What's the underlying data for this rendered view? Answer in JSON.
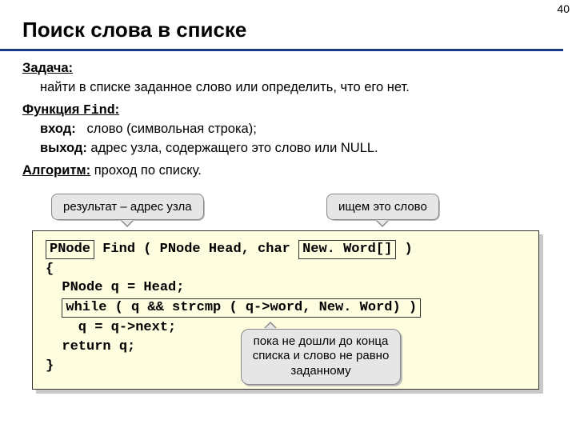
{
  "page_number": "40",
  "title": "Поиск слова в списке",
  "task": {
    "label": "Задача:",
    "text": "найти в списке заданное слово или определить, что его нет."
  },
  "func": {
    "label_prefix": "Функция ",
    "name": "Find",
    "colon": ":",
    "in_label": "вход:",
    "in_text": "   слово (символьная строка);",
    "out_label": "выход:",
    "out_text": " адрес узла, содержащего это слово или NULL."
  },
  "algo": {
    "label": "Алгоритм:",
    "text": " проход по списку."
  },
  "callouts": {
    "result": "результат – адрес узла",
    "search": "ищем это слово",
    "loop": "пока не дошли до конца списка и слово не равно заданному"
  },
  "code": {
    "sig_pre": "PNode",
    "sig_post": " Find ( PNode Head, char ",
    "sig_nw": "New. Word[]",
    "sig_end": " )",
    "l2": "{",
    "l3": "  PNode q = Head;",
    "l4box": "while ( q && strcmp ( q->word, New. Word) )",
    "l5": "    q = q->next;",
    "l6": "  return q;",
    "l7": "}"
  }
}
